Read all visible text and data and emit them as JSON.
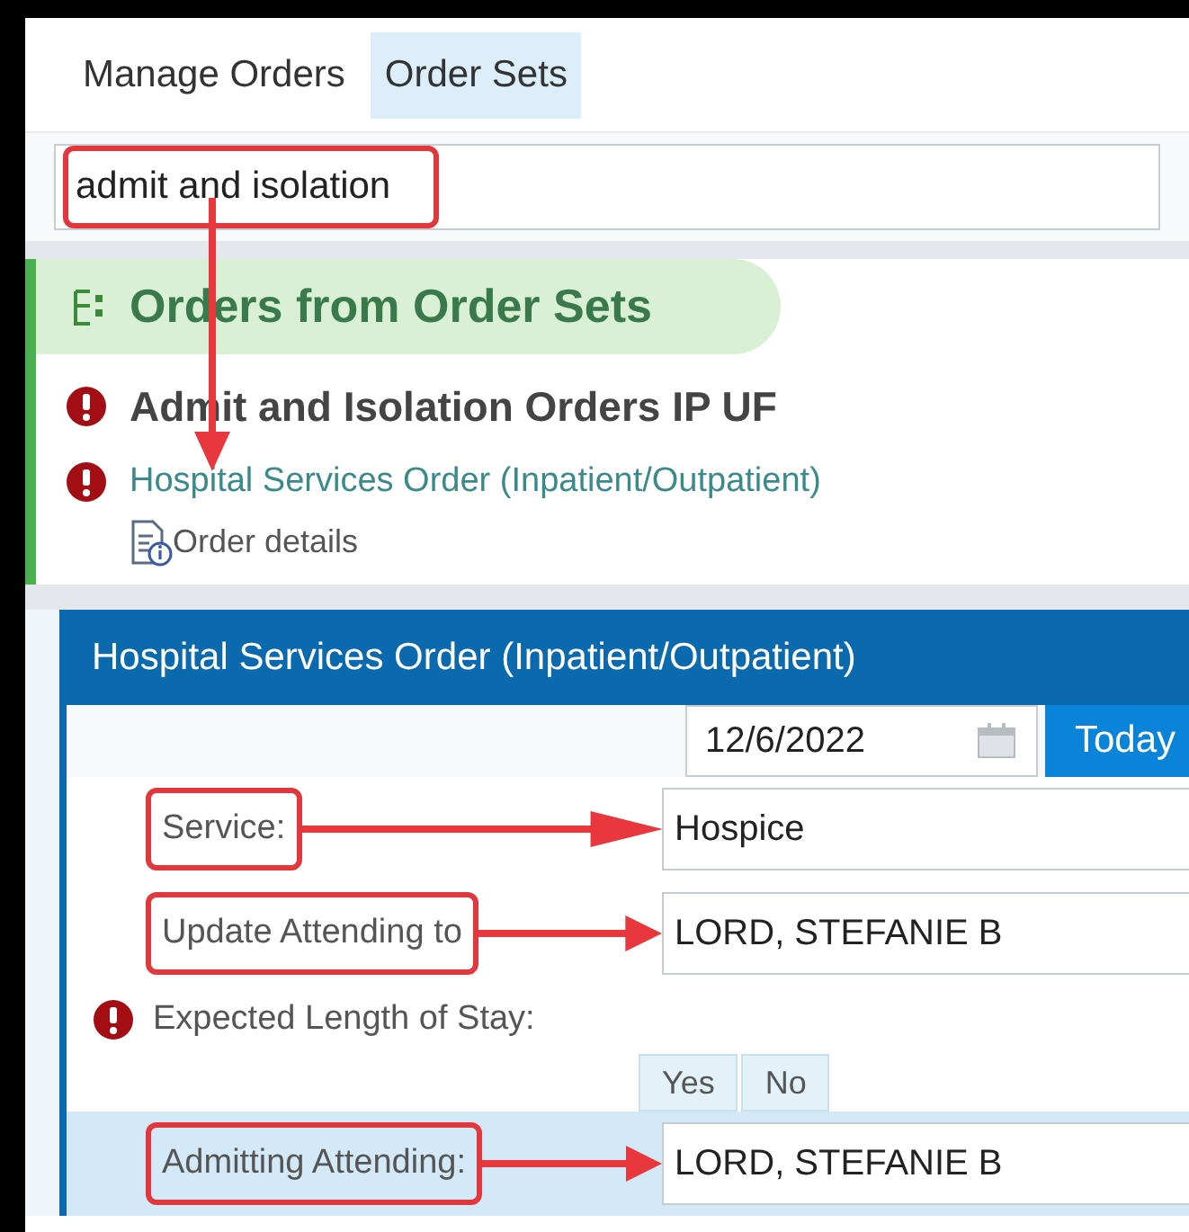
{
  "tabs": [
    {
      "label": "Manage Orders",
      "selected": false
    },
    {
      "label": "Order Sets",
      "selected": true
    }
  ],
  "search": {
    "value": "admit and isolation",
    "highlighted": true
  },
  "order_group": {
    "title": "Orders from Order Sets",
    "order_set": {
      "name": "Admit and Isolation Orders IP UF",
      "required": true
    },
    "order": {
      "name": "Hospital Services Order (Inpatient/Outpatient)",
      "required": true
    },
    "details_link": "Order details"
  },
  "form": {
    "title": "Hospital Services Order (Inpatient/Outpatient)",
    "date": "12/6/2022",
    "today_button": "Today",
    "fields": [
      {
        "kind": "text",
        "label": "Service:",
        "value": "Hospice",
        "highlighted": true,
        "selected": false
      },
      {
        "kind": "text",
        "label": "Update Attending to",
        "value": "LORD, STEFANIE B",
        "highlighted": true,
        "selected": false
      },
      {
        "kind": "choice",
        "label": "Expected Length of Stay:",
        "required": true,
        "options": [
          {
            "label": "Yes",
            "selected": false
          },
          {
            "label": "No",
            "selected": false
          }
        ]
      },
      {
        "kind": "text",
        "label": "Admitting Attending:",
        "value": "LORD, STEFANIE B",
        "highlighted": true,
        "selected": true
      }
    ]
  }
}
